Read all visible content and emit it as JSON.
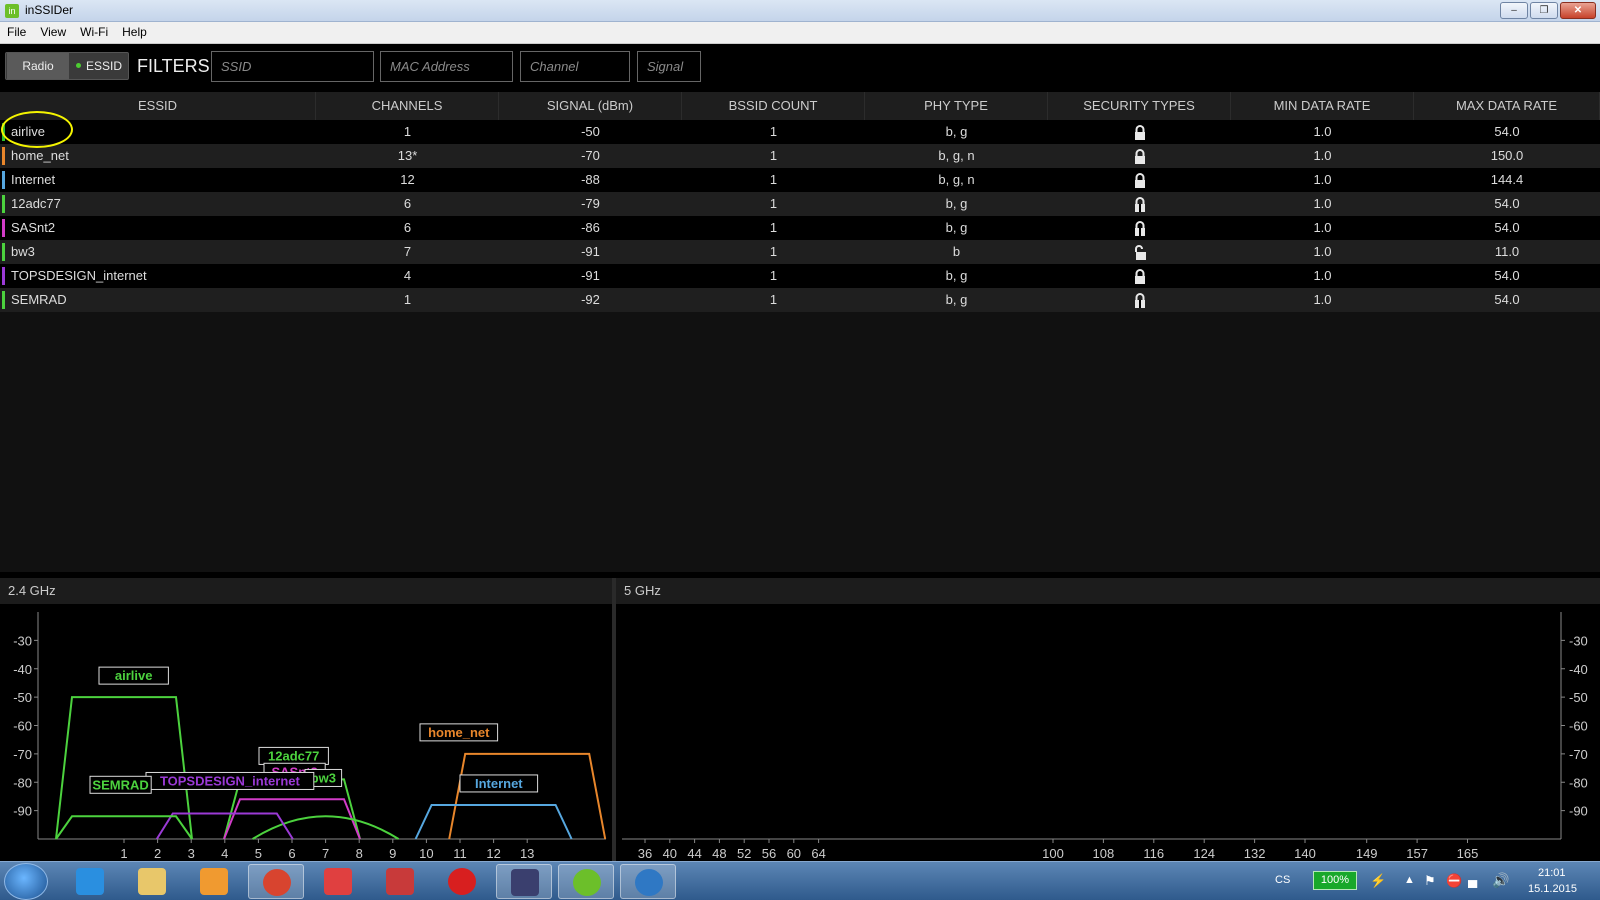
{
  "window": {
    "title": "inSSIDer",
    "app_icon": "in"
  },
  "menu": [
    "File",
    "View",
    "Wi-Fi",
    "Help"
  ],
  "toggle": {
    "radio": "Radio",
    "essid": "ESSID"
  },
  "filters": {
    "label": "FILTERS:",
    "ssid_placeholder": "SSID",
    "mac_placeholder": "MAC Address",
    "channel_placeholder": "Channel",
    "signal_placeholder": "Signal"
  },
  "table": {
    "headers": [
      "ESSID",
      "CHANNELS",
      "SIGNAL (dBm)",
      "BSSID COUNT",
      "PHY TYPE",
      "SECURITY TYPES",
      "MIN DATA RATE",
      "MAX DATA RATE"
    ],
    "rows": [
      {
        "essid": "airlive",
        "channels": "1",
        "signal": "-50",
        "bssid_count": "1",
        "phy": "b, g",
        "security": "lock",
        "min_rate": "1.0",
        "max_rate": "54.0",
        "color": "#2dbd2d"
      },
      {
        "essid": "home_net",
        "channels": "13*",
        "signal": "-70",
        "bssid_count": "1",
        "phy": "b, g, n",
        "security": "lock",
        "min_rate": "1.0",
        "max_rate": "150.0",
        "color": "#e8862b"
      },
      {
        "essid": "Internet",
        "channels": "12",
        "signal": "-88",
        "bssid_count": "1",
        "phy": "b, g, n",
        "security": "lock",
        "min_rate": "1.0",
        "max_rate": "144.4",
        "color": "#56a7df"
      },
      {
        "essid": "12adc77",
        "channels": "6",
        "signal": "-79",
        "bssid_count": "1",
        "phy": "b, g",
        "security": "lock-weak",
        "min_rate": "1.0",
        "max_rate": "54.0",
        "color": "#4cd23e"
      },
      {
        "essid": "SASnt2",
        "channels": "6",
        "signal": "-86",
        "bssid_count": "1",
        "phy": "b, g",
        "security": "lock-weak",
        "min_rate": "1.0",
        "max_rate": "54.0",
        "color": "#d23cc8"
      },
      {
        "essid": "bw3",
        "channels": "7",
        "signal": "-91",
        "bssid_count": "1",
        "phy": "b",
        "security": "unlock",
        "min_rate": "1.0",
        "max_rate": "11.0",
        "color": "#4cd23e"
      },
      {
        "essid": "TOPSDESIGN_internet",
        "channels": "4",
        "signal": "-91",
        "bssid_count": "1",
        "phy": "b, g",
        "security": "lock",
        "min_rate": "1.0",
        "max_rate": "54.0",
        "color": "#9b3ad6"
      },
      {
        "essid": "SEMRAD",
        "channels": "1",
        "signal": "-92",
        "bssid_count": "1",
        "phy": "b, g",
        "security": "lock-weak",
        "min_rate": "1.0",
        "max_rate": "54.0",
        "color": "#4cd23e"
      }
    ]
  },
  "band24": {
    "title": "2.4 GHz",
    "y_ticks": [
      "-30",
      "-40",
      "-50",
      "-60",
      "-70",
      "-80",
      "-90"
    ],
    "x_ticks": [
      "1",
      "2",
      "3",
      "4",
      "5",
      "6",
      "7",
      "8",
      "9",
      "10",
      "11",
      "12",
      "13"
    ],
    "networks": [
      {
        "label": "airlive",
        "channel": 1,
        "signal": -50,
        "color": "#4cd23e"
      },
      {
        "label": "home_net",
        "channel": 13,
        "signal": -70,
        "color": "#e8862b"
      },
      {
        "label": "Internet",
        "channel": 12,
        "signal": -88,
        "color": "#56a7df"
      },
      {
        "label": "12adc77",
        "channel": 6,
        "signal": -79,
        "color": "#4cd23e"
      },
      {
        "label": "SASnt2",
        "channel": 6,
        "signal": -86,
        "color": "#d23cc8"
      },
      {
        "label": "bw3",
        "channel": 7,
        "signal": -91,
        "color": "#4cd23e"
      },
      {
        "label": "TOPSDESIGN_internet",
        "channel": 4,
        "signal": -91,
        "color": "#9b3ad6"
      },
      {
        "label": "SEMRAD",
        "channel": 1,
        "signal": -92,
        "color": "#4cd23e"
      }
    ]
  },
  "band5": {
    "title": "5 GHz",
    "y_ticks": [
      "-30",
      "-40",
      "-50",
      "-60",
      "-70",
      "-80",
      "-90"
    ],
    "x_ticks": [
      "36",
      "40",
      "44",
      "48",
      "52",
      "56",
      "60",
      "64",
      "100",
      "108",
      "116",
      "124",
      "132",
      "140",
      "149",
      "157",
      "165"
    ]
  },
  "taskbar": {
    "language": "CS",
    "battery": "100%",
    "time": "21:01",
    "date": "15.1.2015",
    "apps": [
      "internet-explorer",
      "file-explorer",
      "media-player",
      "chrome",
      "app-grid",
      "mail",
      "opera",
      "save-app",
      "inssider",
      "thunderbird"
    ]
  }
}
